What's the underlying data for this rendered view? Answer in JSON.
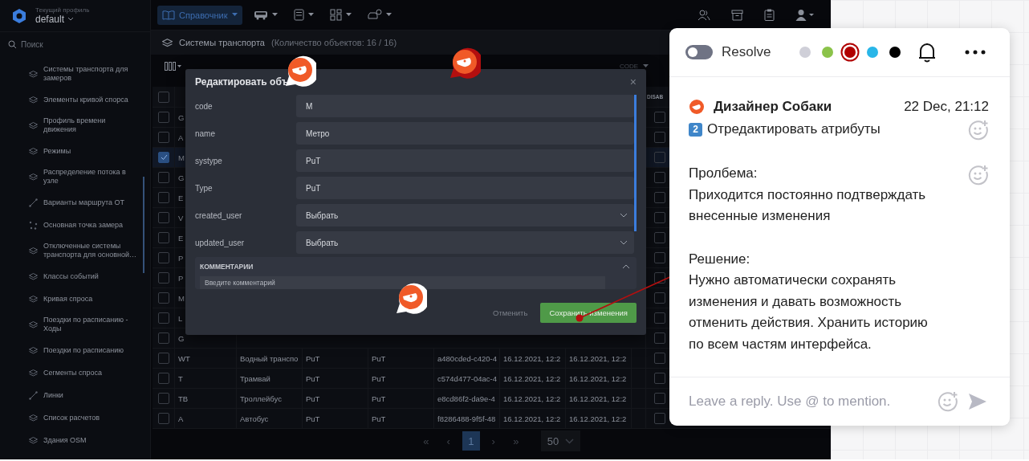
{
  "sidebar": {
    "profile_label": "Текущий профиль",
    "profile": "default",
    "search_placeholder": "Поиск",
    "items": [
      {
        "label": "Системы транспорта для замеров",
        "kind": "layers"
      },
      {
        "label": "Элементы кривой спорса",
        "kind": "layers"
      },
      {
        "label": "Профиль времени движения",
        "kind": "layers"
      },
      {
        "label": "Режимы",
        "kind": "layers"
      },
      {
        "label": "Распределение потока в узле",
        "kind": "layers"
      },
      {
        "label": "Варианты маршрута ОТ",
        "kind": "route"
      },
      {
        "label": "Основная точка замера",
        "kind": "points"
      },
      {
        "label": "Отключенные системы транспорта для основной…",
        "kind": "layers"
      },
      {
        "label": "Классы событий",
        "kind": "layers"
      },
      {
        "label": "Кривая спроса",
        "kind": "layers"
      },
      {
        "label": "Поездки по расписанию - Ходы",
        "kind": "layers"
      },
      {
        "label": "Поездки по расписанию",
        "kind": "layers"
      },
      {
        "label": "Сегменты спроса",
        "kind": "layers"
      },
      {
        "label": "Линки",
        "kind": "route"
      },
      {
        "label": "Список расчетов",
        "kind": "layers"
      },
      {
        "label": "Здания OSM",
        "kind": "layers"
      }
    ]
  },
  "topbar": {
    "nav": [
      {
        "kind": "book",
        "label": "Справочник",
        "selected": true
      },
      {
        "kind": "bus",
        "selected": false
      },
      {
        "kind": "calculator",
        "selected": false
      },
      {
        "kind": "grid",
        "selected": false
      },
      {
        "kind": "car",
        "selected": false
      }
    ],
    "actions": [
      {
        "kind": "users"
      },
      {
        "kind": "archive"
      },
      {
        "kind": "clipboard"
      },
      {
        "kind": "user"
      }
    ]
  },
  "page": {
    "title": "Системы транспорта",
    "count": "(Количество объектов: 16 / 16)",
    "sort": "CODE"
  },
  "table": {
    "last_column": "DISAB",
    "header_checked": false,
    "rows": [
      {
        "code": "G",
        "checked": false,
        "disabled": false
      },
      {
        "code": "A",
        "checked": false,
        "disabled": false
      },
      {
        "code": "M",
        "checked": true,
        "disabled": false
      },
      {
        "code": "G",
        "checked": false,
        "disabled": false
      },
      {
        "code": "E",
        "checked": false,
        "disabled": false
      },
      {
        "code": "V",
        "checked": false,
        "disabled": false
      },
      {
        "code": "E",
        "checked": false,
        "disabled": false
      },
      {
        "code": "P",
        "checked": false,
        "disabled": false
      },
      {
        "code": "P",
        "checked": false,
        "disabled": false
      },
      {
        "code": "M",
        "checked": false,
        "disabled": false
      },
      {
        "code": "L",
        "checked": false,
        "disabled": false
      },
      {
        "code": "G",
        "checked": false,
        "disabled": false
      },
      {
        "code": "WT",
        "name": "Водный транспо",
        "systype": "PuT",
        "type": "PuT",
        "id": "a480cded-c420-4",
        "created": "16.12.2021, 12:2",
        "updated": "16.12.2021, 12:2",
        "checked": false,
        "disabled": false
      },
      {
        "code": "T",
        "name": "Трамвай",
        "systype": "PuT",
        "type": "PuT",
        "id": "c574d477-04ac-4",
        "created": "16.12.2021, 12:2",
        "updated": "16.12.2021, 12:2",
        "checked": false,
        "disabled": false
      },
      {
        "code": "TB",
        "name": "Троллейбус",
        "systype": "PuT",
        "type": "PuT",
        "id": "e8cd86f2-da9e-4",
        "created": "16.12.2021, 12:2",
        "updated": "16.12.2021, 12:2",
        "checked": false,
        "disabled": false
      },
      {
        "code": "A",
        "name": "Автобус",
        "systype": "PuT",
        "type": "PuT",
        "id": "f8286488-9f5f-48",
        "created": "16.12.2021, 12:2",
        "updated": "16.12.2021, 12:2",
        "checked": false,
        "disabled": false
      }
    ]
  },
  "pagination": {
    "prev": [
      "«",
      "‹"
    ],
    "pages": [
      {
        "label": "1",
        "selected": true
      }
    ],
    "next": [
      "›",
      "»"
    ],
    "page_size": "50"
  },
  "modal": {
    "title": "Редактировать объ",
    "close": "×",
    "fields": [
      {
        "label": "code",
        "value": "M",
        "kind": "text"
      },
      {
        "label": "name",
        "value": "Метро",
        "kind": "text"
      },
      {
        "label": "systype",
        "value": "PuT",
        "kind": "text"
      },
      {
        "label": "Type",
        "value": "PuT",
        "kind": "text"
      },
      {
        "label": "created_user",
        "value": "Выбрать",
        "kind": "select"
      },
      {
        "label": "updated_user",
        "value": "Выбрать",
        "kind": "select"
      }
    ],
    "comments_title": "КОММЕНТАРИИ",
    "comment_placeholder": "Введите комментарий",
    "cancel": "Отменить",
    "save": "Сохранить изменения"
  },
  "pins": [
    {
      "selected": false
    },
    {
      "selected": true
    },
    {
      "selected": false
    }
  ],
  "popup": {
    "resolve": {
      "label": "Resolve",
      "on": false
    },
    "colors": [
      {
        "color": "#cfcfd8",
        "selected": false
      },
      {
        "color": "#8bc34a",
        "selected": false
      },
      {
        "color": "#b00000",
        "selected": true
      },
      {
        "color": "#29b6e8",
        "selected": false
      },
      {
        "color": "#000000",
        "selected": false
      }
    ],
    "comment": {
      "author": "Дизайнер Собаки",
      "time": "22 Dec, 21:12",
      "badge": "2",
      "title": "Отредактировать атрибуты",
      "blocks": [
        "Пролбема:\nПриходится постоянно подтверждать внесенные изменения",
        "Решение:\nНужно автоматически сохранять изменения и давать возможность отменить действия. Хранить историю по всем частям интерфейса."
      ]
    },
    "reply_placeholder": "Leave a reply. Use @ to mention."
  }
}
